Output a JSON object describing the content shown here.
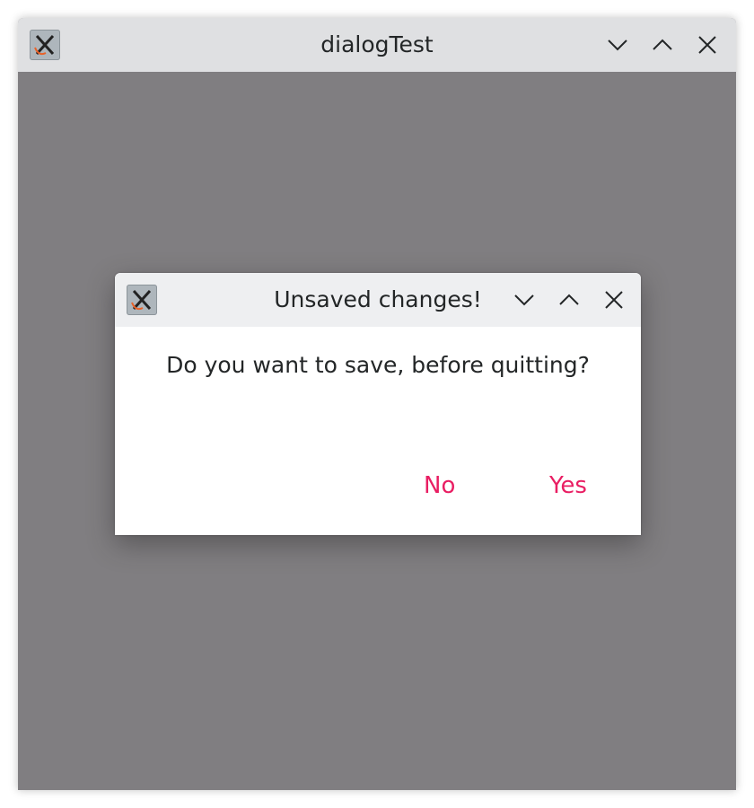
{
  "main_window": {
    "title": "dialogTest",
    "icons": {
      "app": "x-app-icon",
      "minimize": "chevron-down-icon",
      "maximize": "chevron-up-icon",
      "close": "close-icon"
    }
  },
  "dialog": {
    "title": "Unsaved changes!",
    "message": "Do you want to save, before quitting?",
    "buttons": {
      "no_label": "No",
      "yes_label": "Yes"
    }
  },
  "colors": {
    "accent": "#e91e63",
    "background": "#807e81",
    "titlebar_main": "#dfe0e2",
    "titlebar_dialog": "#eeeff1"
  }
}
